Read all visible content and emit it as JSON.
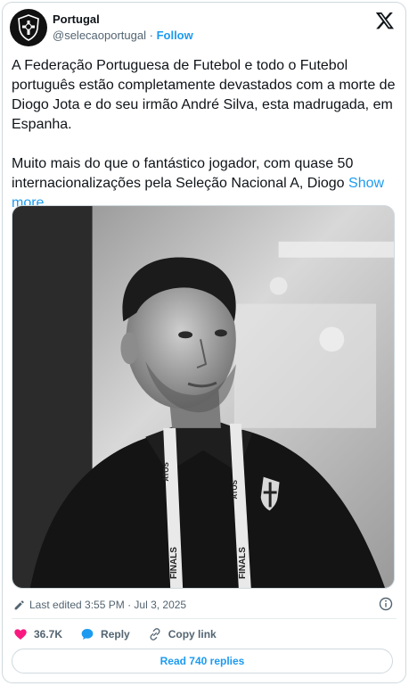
{
  "header": {
    "name": "Portugal",
    "handle": "@selecaoportugal",
    "separator": "·",
    "follow_label": "Follow"
  },
  "tweet": {
    "paragraph1": "A Federação Portuguesa de Futebol e todo o Futebol português estão completamente devastados com a morte de Diogo Jota e do seu irmão André Silva, esta madrugada, em Espanha.",
    "paragraph2": "Muito mais do que o fantástico jogador, com quase 50 internacionalizações pela Seleção Nacional A, Diogo",
    "show_more": "Show more"
  },
  "photo": {
    "lanyard_text_1": "FINALS",
    "lanyard_text_2": "FINALS",
    "brand_text": "ATOS"
  },
  "meta": {
    "edited_text": "Last edited 3:55 PM · Jul 3, 2025"
  },
  "actions": {
    "likes": "36.7K",
    "reply_label": "Reply",
    "copy_link_label": "Copy link"
  },
  "read_replies_label": "Read 740 replies",
  "colors": {
    "accent": "#1d9bf0",
    "heart": "#f91880",
    "muted": "#536471"
  },
  "icons": [
    "fpf-crest-icon",
    "x-logo-icon",
    "pencil-icon",
    "info-icon",
    "heart-icon",
    "reply-icon",
    "link-icon"
  ]
}
